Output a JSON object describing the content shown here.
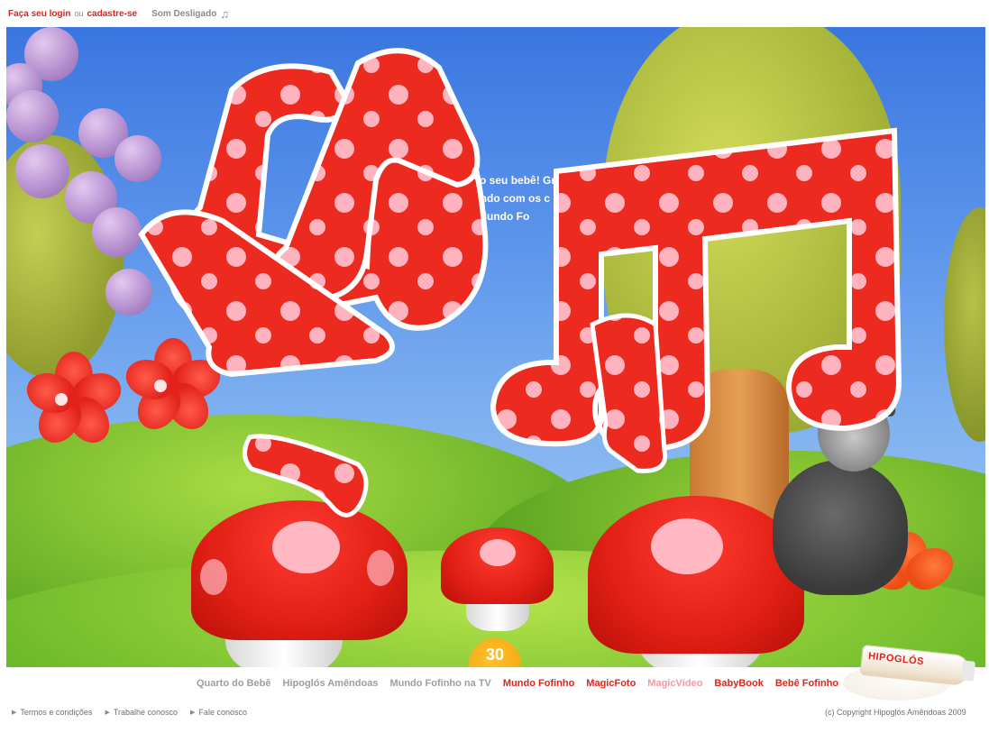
{
  "topbar": {
    "login_label": "Faça seu login",
    "ou_label": "ou",
    "signup_label": "cadastre-se",
    "sound_label": "Som Desligado",
    "sound_icon": "music-note-icon"
  },
  "stage": {
    "overlay_lines": [
      "a é o seu bebê! Gra",
      "ncando com os c",
      "do Mundo Fo"
    ],
    "timer_value": "30"
  },
  "footer_nav": {
    "items": [
      {
        "label": "Quarto do Bebê",
        "color": "#9e9e9e"
      },
      {
        "label": "Hipoglós Amêndoas",
        "color": "#9e9e9e"
      },
      {
        "label": "Mundo Fofinho na TV",
        "color": "#9e9e9e"
      },
      {
        "label": "Mundo Fofinho",
        "color": "#e0241b"
      },
      {
        "label": "MagicFoto",
        "color": "#e0241b"
      },
      {
        "label": "MagicVídeo",
        "color": "#f29aa3"
      },
      {
        "label": "BabyBook",
        "color": "#e0241b"
      },
      {
        "label": "Bebê Fofinho",
        "color": "#e0241b"
      }
    ]
  },
  "footer_links": {
    "items": [
      "Termos e condições",
      "Trabalhe conosco",
      "Fale conosco"
    ],
    "copyright": "(c) Copyright Hipoglós Amêndoas 2009"
  },
  "product": {
    "brand": "HIPOGLÓS"
  },
  "colors": {
    "accent_red": "#e0241b",
    "muted_grey": "#9e9e9e",
    "pink": "#f29aa3"
  }
}
